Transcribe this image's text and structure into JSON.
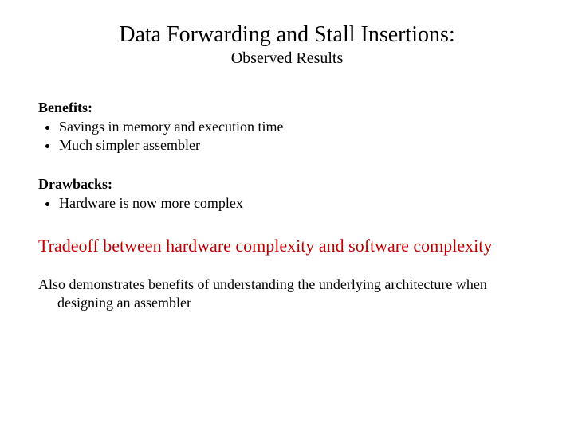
{
  "title": "Data Forwarding and Stall Insertions:",
  "subtitle": "Observed Results",
  "benefits": {
    "heading": "Benefits:",
    "items": [
      "Savings in memory and execution time",
      "Much simpler assembler"
    ]
  },
  "drawbacks": {
    "heading": "Drawbacks:",
    "items": [
      "Hardware is now more complex"
    ]
  },
  "tradeoff": "Tradeoff between hardware complexity and software complexity",
  "closing_line1": "Also demonstrates benefits of understanding the underlying architecture when",
  "closing_line2": "designing an assembler"
}
